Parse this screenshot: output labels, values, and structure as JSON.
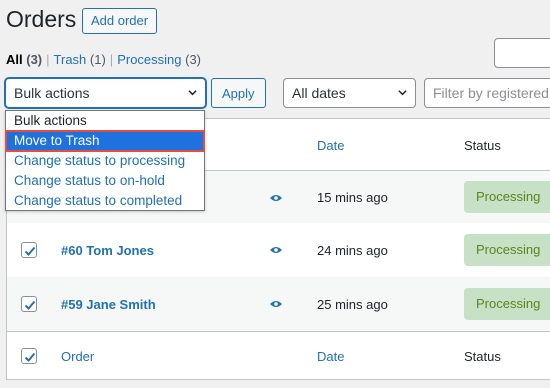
{
  "header": {
    "title": "Orders",
    "add_button": "Add order"
  },
  "views": [
    {
      "label": "All",
      "count": "(3)"
    },
    {
      "label": "Trash",
      "count": "(1)"
    },
    {
      "label": "Processing",
      "count": "(3)"
    }
  ],
  "filters": {
    "bulk_select": "Bulk actions",
    "apply": "Apply",
    "dates_select": "All dates",
    "customer_placeholder": "Filter by registered customer"
  },
  "bulk_options": [
    "Bulk actions",
    "Move to Trash",
    "Change status to processing",
    "Change status to on-hold",
    "Change status to completed"
  ],
  "table": {
    "columns": {
      "order": "Order",
      "date": "Date",
      "status": "Status"
    },
    "rows": [
      {
        "order": "",
        "date": "15 mins ago",
        "status": "Processing"
      },
      {
        "order": "#60 Tom Jones",
        "date": "24 mins ago",
        "status": "Processing"
      },
      {
        "order": "#59 Jane Smith",
        "date": "25 mins ago",
        "status": "Processing"
      }
    ]
  },
  "colors": {
    "accent": "#2271b1",
    "processing_bg": "#c6e1c6",
    "processing_text": "#5b841b",
    "highlight": "#1e72e0",
    "callout": "#e74c3c"
  },
  "icons": {
    "preview": "eye-icon",
    "select_arrow": "chevron-down-icon",
    "checked": "checkmark-icon"
  }
}
